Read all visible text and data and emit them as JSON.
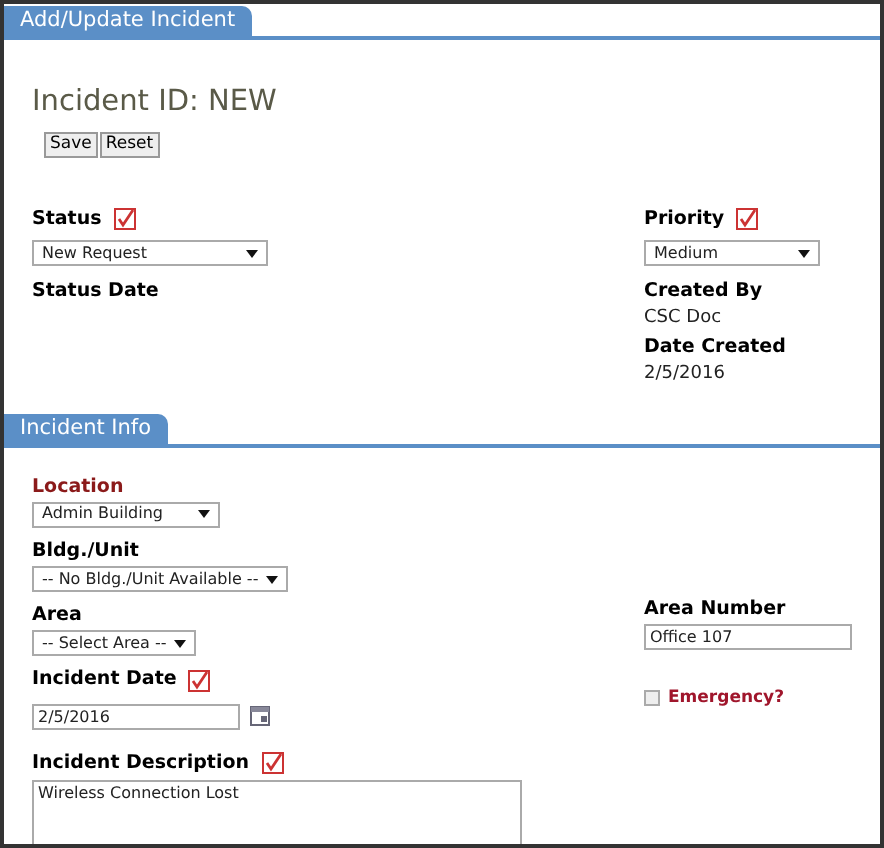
{
  "header": {
    "tab": "Add/Update Incident",
    "title": "Incident ID: NEW",
    "buttons": [
      "Save",
      "Reset"
    ]
  },
  "status": {
    "label": "Status",
    "required": true,
    "value": "New Request"
  },
  "priority": {
    "label": "Priority",
    "required": true,
    "value": "Medium"
  },
  "status_date": {
    "label": "Status Date"
  },
  "created_by": {
    "label": "Created By",
    "value": "CSC Doc"
  },
  "date_created": {
    "label": "Date Created",
    "value": "2/5/2016"
  },
  "incident_info": {
    "tab": "Incident Info",
    "location": {
      "label": "Location",
      "required": false,
      "value": "Admin Building"
    },
    "unit": {
      "label": "Bldg./Unit",
      "required": false,
      "value": "-- No Bldg./Unit Available --"
    },
    "area": {
      "label": "Area",
      "required": false,
      "value": "-- Select Area --"
    },
    "area_number": {
      "label": "Area Number",
      "value": "Office 107"
    },
    "incident_date": {
      "label": "Incident Date",
      "required": true,
      "value": "2/5/2016"
    },
    "emergency": {
      "label": "Emergency?",
      "checked": false
    },
    "description": {
      "label": "Incident Description",
      "required": true,
      "value": "Wireless Connection Lost"
    }
  }
}
